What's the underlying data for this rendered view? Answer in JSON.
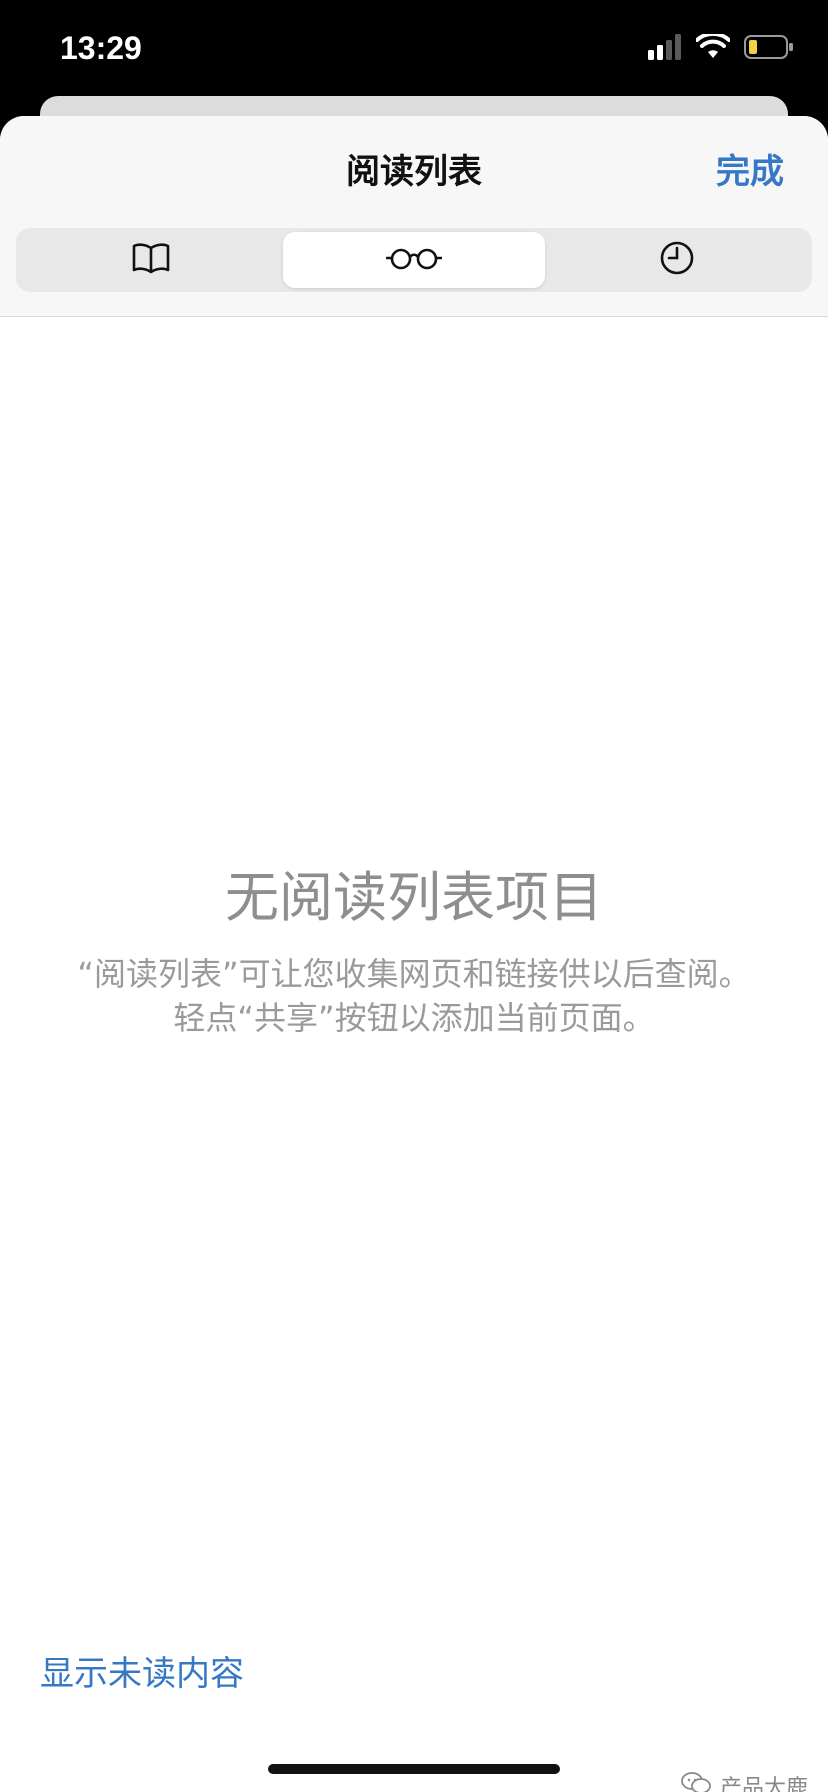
{
  "status_bar": {
    "time": "13:29",
    "icons": [
      "signal-icon",
      "wifi-icon",
      "battery-icon"
    ]
  },
  "header": {
    "title": "阅读列表",
    "done_label": "完成"
  },
  "tabs": [
    {
      "icon": "bookmarks-book-icon",
      "active": false
    },
    {
      "icon": "reading-list-glasses-icon",
      "active": true
    },
    {
      "icon": "history-clock-icon",
      "active": false
    }
  ],
  "empty_state": {
    "title": "无阅读列表项目",
    "description": "“阅读列表”可让您收集网页和链接供以后查阅。轻点“共享”按钮以添加当前页面。"
  },
  "footer": {
    "show_unread_label": "显示未读内容"
  },
  "watermark": {
    "text": "产品大鹿"
  },
  "colors": {
    "accent": "#3478c6",
    "empty_text": "#8e8e8e",
    "header_bg": "#f7f7f7"
  }
}
